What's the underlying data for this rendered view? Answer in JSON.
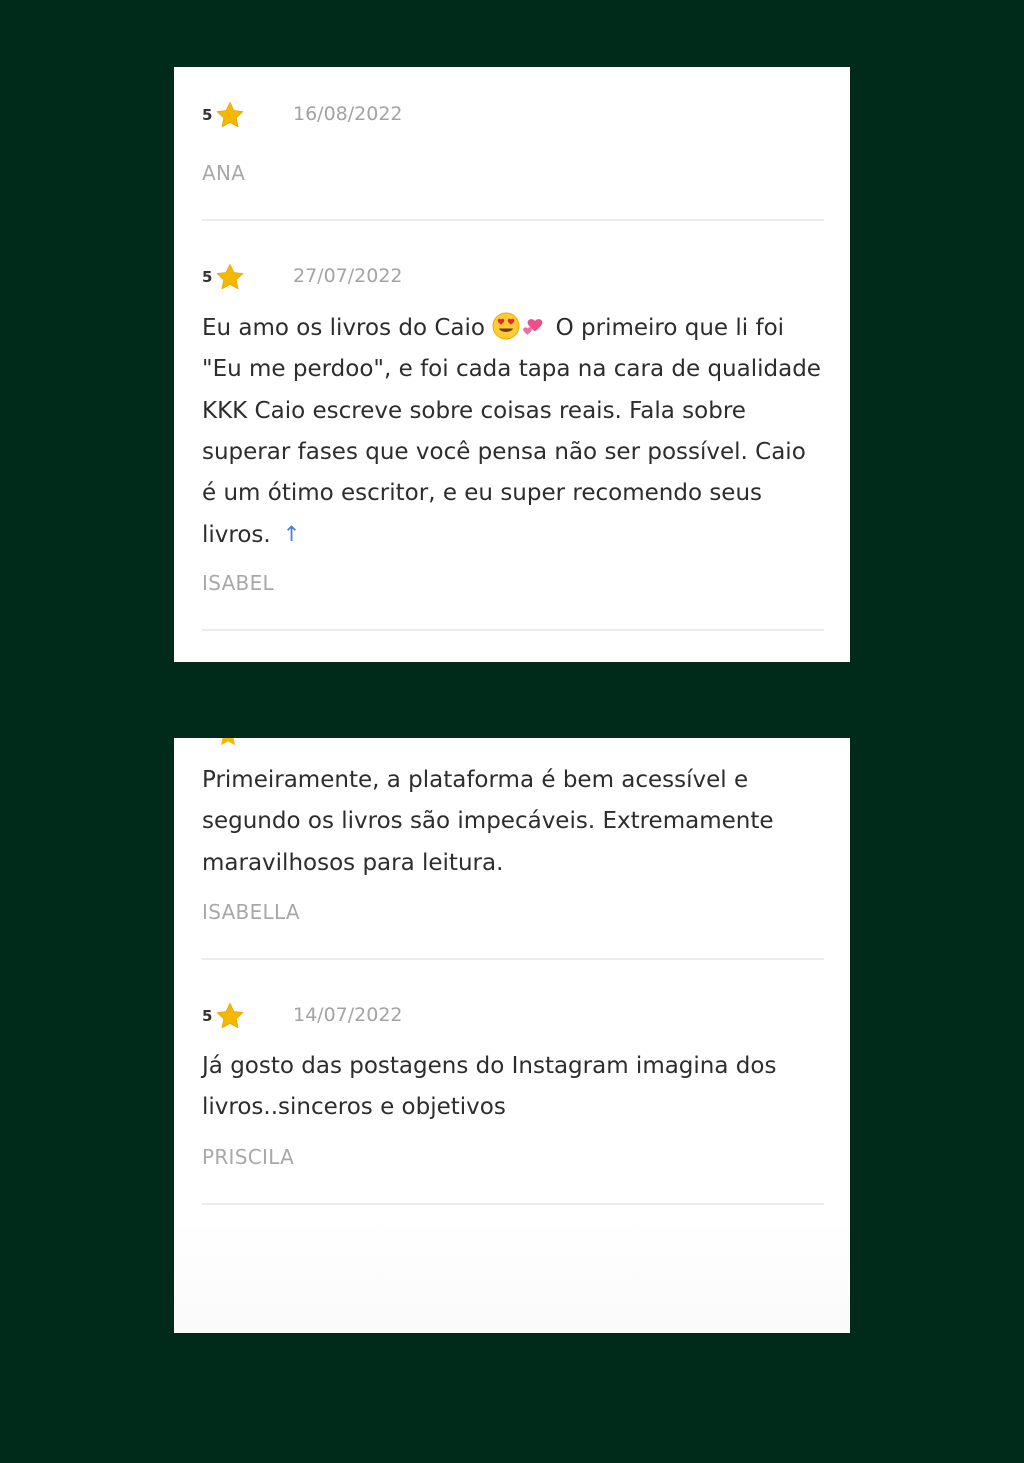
{
  "colors": {
    "background": "#002b1a",
    "card": "#ffffff",
    "star": "#f5b800",
    "date": "#a3a3a3",
    "author": "#a8a8a8",
    "text": "#2d2d2d",
    "link_arrow": "#4f7fd4"
  },
  "reviews": [
    {
      "rating": "5",
      "icon": "star-icon",
      "date": "16/08/2022",
      "text": "",
      "author": "ANA"
    },
    {
      "rating": "5",
      "icon": "star-icon",
      "date": "27/07/2022",
      "text_part1": "Eu amo os livros do Caio ",
      "emojis": [
        "smiling-face-with-heart-eyes",
        "two-hearts"
      ],
      "text_part2": " O primeiro que li foi \"Eu me perdoo\", e foi cada tapa na cara de qualidade KKK Caio escreve sobre coisas reais. Fala sobre superar fases que você pensa não ser possível. Caio é um ótimo escritor, e eu super recomendo seus livros.",
      "collapse_icon": "arrow-up-icon",
      "author": "ISABEL"
    },
    {
      "text": "Primeiramente, a plataforma é bem acessível e segundo os livros são impecáveis. Extremamente maravilhosos para leitura.",
      "author": "ISABELLA"
    },
    {
      "rating": "5",
      "icon": "star-icon",
      "date": "14/07/2022",
      "text": "Já gosto das postagens do Instagram imagina dos livros..sinceros e objetivos",
      "author": "PRISCILA"
    }
  ]
}
